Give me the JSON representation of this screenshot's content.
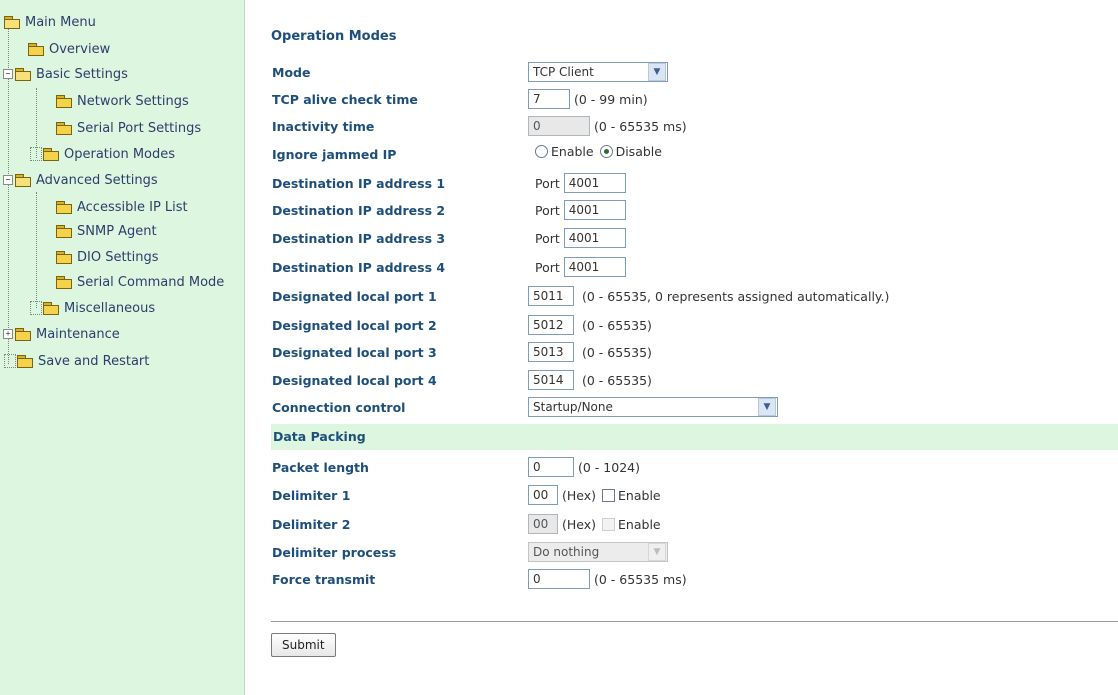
{
  "sidebar": {
    "root": "Main Menu",
    "items": [
      {
        "label": "Overview"
      },
      {
        "label": "Basic Settings"
      },
      {
        "label": "Network Settings"
      },
      {
        "label": "Serial Port Settings"
      },
      {
        "label": "Operation Modes"
      },
      {
        "label": "Advanced Settings"
      },
      {
        "label": "Accessible IP List"
      },
      {
        "label": "SNMP Agent"
      },
      {
        "label": "DIO Settings"
      },
      {
        "label": "Serial Command Mode"
      },
      {
        "label": "Miscellaneous"
      },
      {
        "label": "Maintenance"
      },
      {
        "label": "Save and Restart"
      }
    ],
    "expand_minus": "−",
    "expand_plus": "+"
  },
  "page": {
    "title": "Operation Modes",
    "mode": {
      "label": "Mode",
      "value": "TCP Client"
    },
    "tcp_alive": {
      "label": "TCP alive check time",
      "value": "7",
      "hint": "(0 - 99 min)"
    },
    "inactivity": {
      "label": "Inactivity time",
      "value": "0",
      "hint": "(0 - 65535 ms)"
    },
    "ignore_jammed": {
      "label": "Ignore jammed IP",
      "enable": "Enable",
      "disable": "Disable",
      "selected": "Disable"
    },
    "destinations": [
      {
        "label": "Destination IP address 1",
        "value": "",
        "port_label": "Port",
        "port": "4001"
      },
      {
        "label": "Destination IP address 2",
        "value": "",
        "port_label": "Port",
        "port": "4001"
      },
      {
        "label": "Destination IP address 3",
        "value": "",
        "port_label": "Port",
        "port": "4001"
      },
      {
        "label": "Destination IP address 4",
        "value": "",
        "port_label": "Port",
        "port": "4001"
      }
    ],
    "local_ports": [
      {
        "label": "Designated local port 1",
        "value": "5011",
        "hint": "(0 - 65535, 0 represents assigned automatically.)"
      },
      {
        "label": "Designated local port 2",
        "value": "5012",
        "hint": "(0 - 65535)"
      },
      {
        "label": "Designated local port 3",
        "value": "5013",
        "hint": "(0 - 65535)"
      },
      {
        "label": "Designated local port 4",
        "value": "5014",
        "hint": "(0 - 65535)"
      }
    ],
    "connection_control": {
      "label": "Connection control",
      "value": "Startup/None"
    },
    "data_packing": {
      "section": "Data Packing",
      "packet_length": {
        "label": "Packet length",
        "value": "0",
        "hint": "(0 - 1024)"
      },
      "delimiter1": {
        "label": "Delimiter 1",
        "value": "00",
        "hex": "(Hex)",
        "enable": "Enable"
      },
      "delimiter2": {
        "label": "Delimiter 2",
        "value": "00",
        "hex": "(Hex)",
        "enable": "Enable"
      },
      "delimiter_process": {
        "label": "Delimiter process",
        "value": "Do nothing"
      },
      "force_transmit": {
        "label": "Force transmit",
        "value": "0",
        "hint": "(0 - 65535 ms)"
      }
    },
    "submit": "Submit"
  },
  "colors": {
    "sidebar_bg": "#ddf6df",
    "label_color": "#1d4f7a",
    "section_bg": "#ddf6df"
  },
  "icons": [
    "folder-icon",
    "open-folder-icon",
    "tree-expand-icon",
    "tree-collapse-icon",
    "dropdown-arrow-icon"
  ]
}
